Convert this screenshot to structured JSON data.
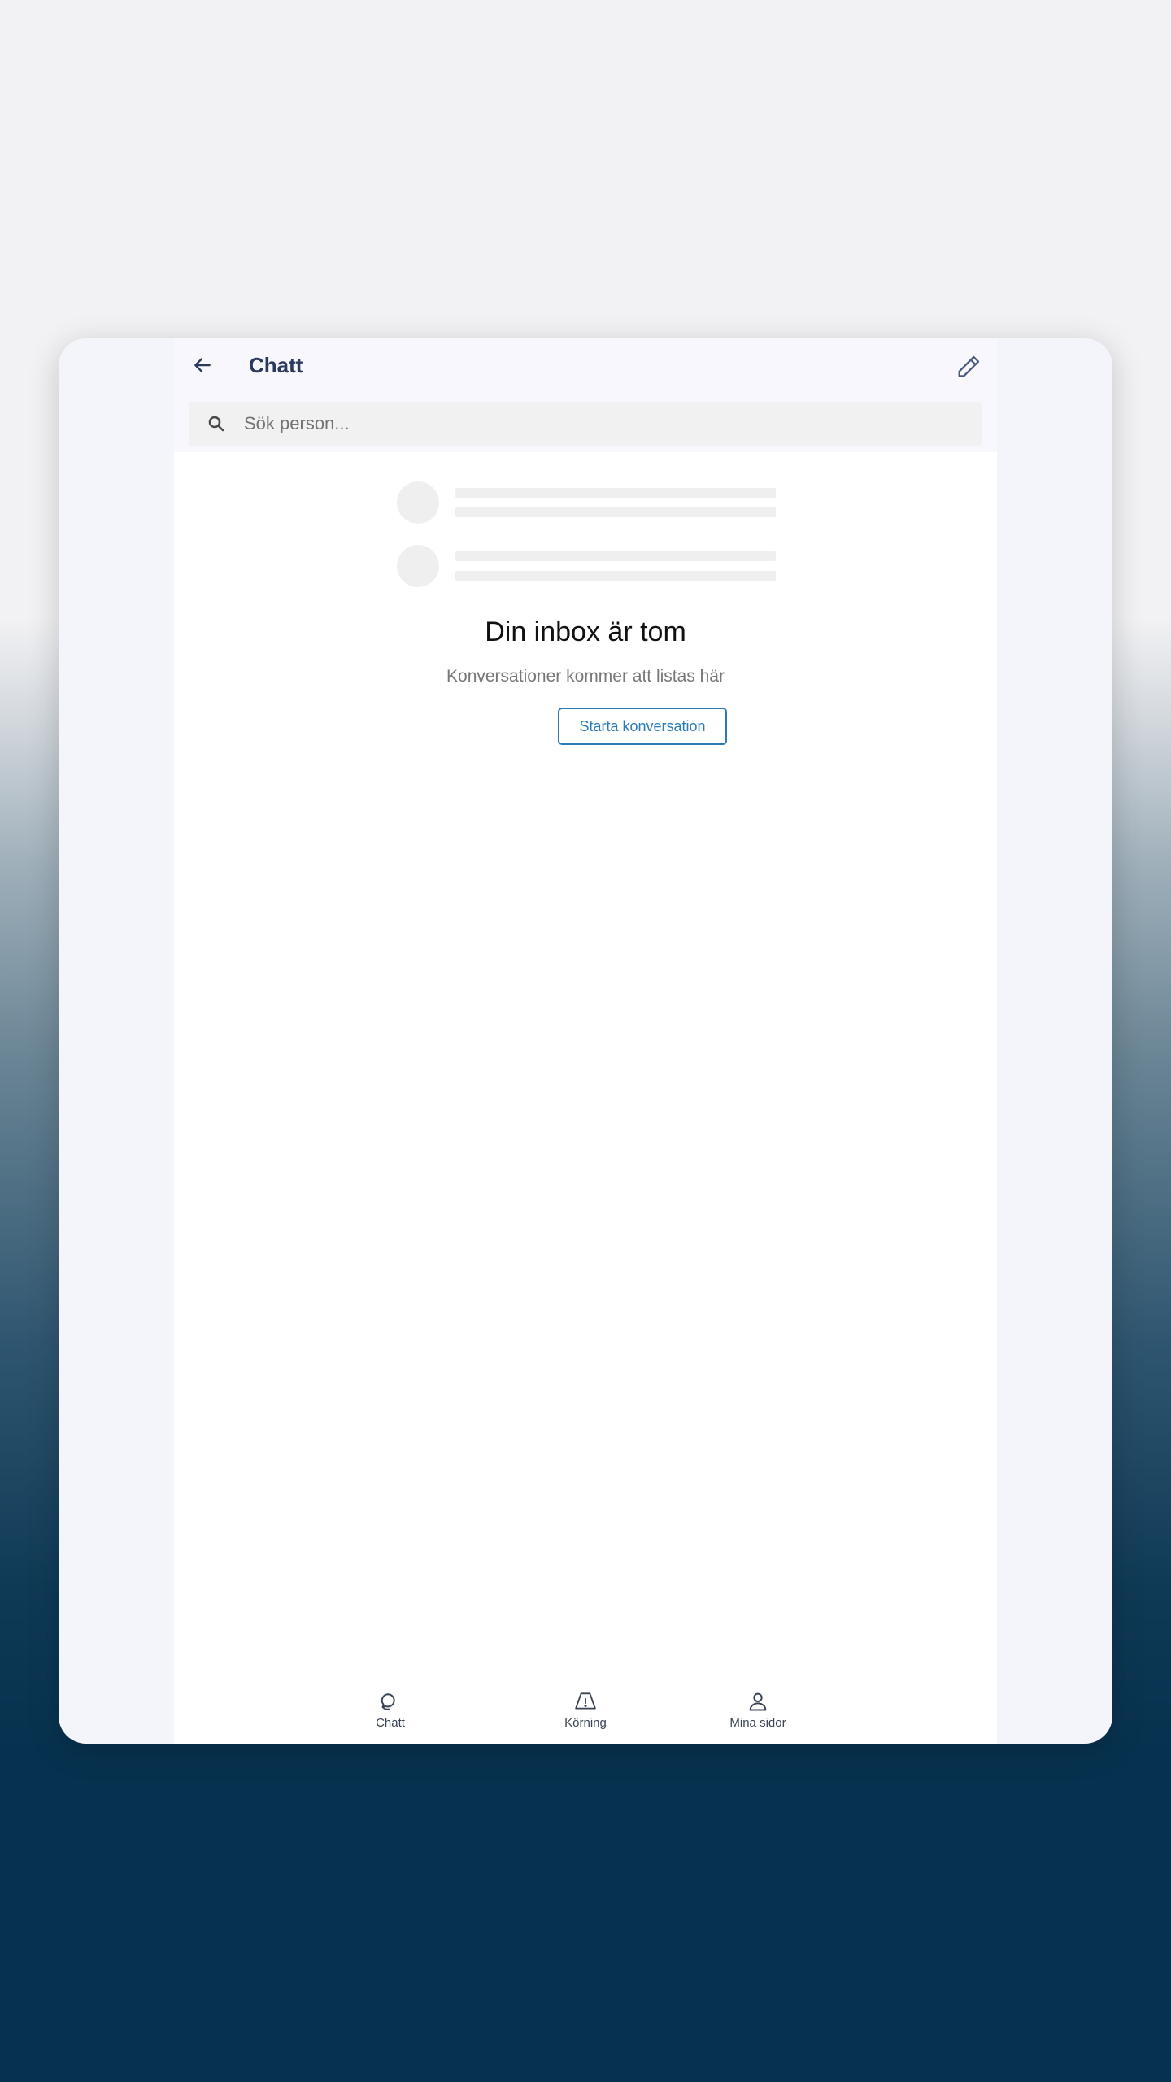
{
  "header": {
    "title": "Chatt",
    "back_icon": "arrow-left-icon",
    "edit_icon": "pencil-icon"
  },
  "search": {
    "placeholder": "Sök person...",
    "value": "",
    "icon": "search-icon"
  },
  "empty_state": {
    "title": "Din inbox är tom",
    "subtitle": "Konversationer kommer att listas här",
    "button_label": "Starta konversation"
  },
  "bottom_nav": {
    "items": [
      {
        "label": "Chatt",
        "icon": "chat-bubbles-icon"
      },
      {
        "label": "Körning",
        "icon": "warning-triangle-icon"
      },
      {
        "label": "Mina sidor",
        "icon": "person-icon"
      }
    ]
  },
  "colors": {
    "accent": "#2b7bb9",
    "title": "#2b3a5c",
    "background_top": "#f2f2f4",
    "background_bottom": "#07324f"
  }
}
